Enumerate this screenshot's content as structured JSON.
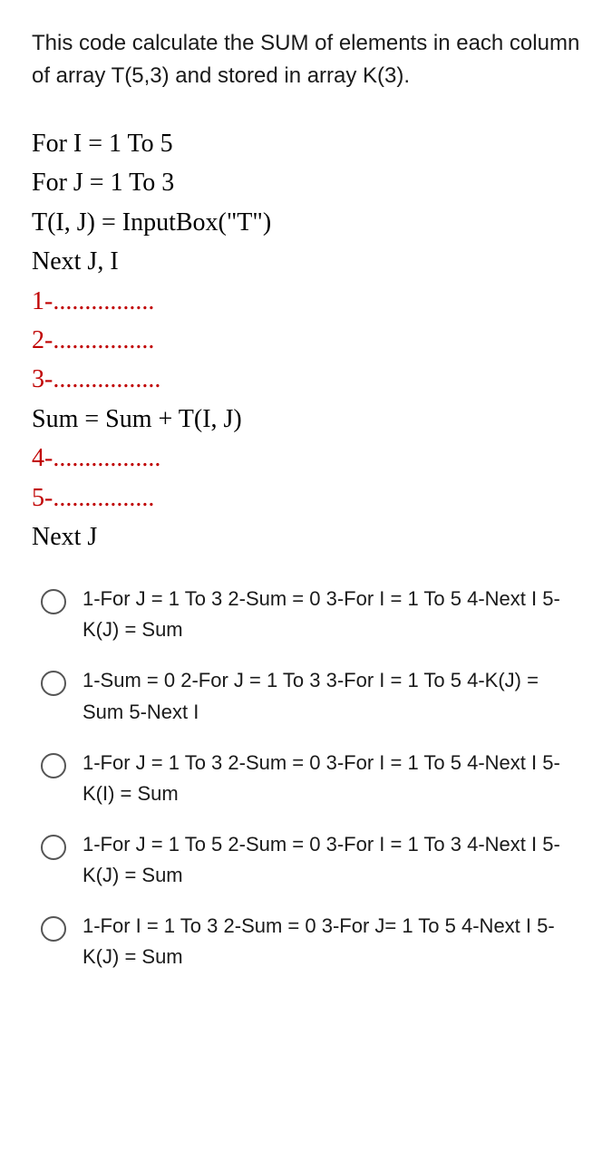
{
  "prompt": "This code calculate the SUM of elements  in each column of array T(5,3) and stored in array K(3).",
  "code": {
    "line1": "For I = 1 To 5",
    "line2": "For J = 1 To 3",
    "line3": "T(I, J) = InputBox(\"T\")",
    "line4": "Next J, I",
    "blank1": "1-................",
    "blank2": "2-................",
    "blank3": "3-.................",
    "eq": "Sum = Sum + T(I, J)",
    "blank4": "4-.................",
    "blank5": "5-................",
    "lineLast": "Next J"
  },
  "options": [
    "1-For J = 1 To 3 2-Sum = 0 3-For I = 1 To 5 4-Next I 5-K(J) = Sum",
    "1-Sum = 0 2-For J = 1 To 3 3-For I = 1 To 5 4-K(J) = Sum 5-Next I",
    "1-For J = 1 To 3 2-Sum = 0 3-For I = 1 To 5 4-Next I 5-K(I) = Sum",
    "1-For J = 1 To 5 2-Sum = 0 3-For I = 1 To 3 4-Next I 5-K(J) = Sum",
    "1-For I = 1 To 3 2-Sum = 0 3-For J= 1 To 5 4-Next I 5-K(J) = Sum"
  ]
}
